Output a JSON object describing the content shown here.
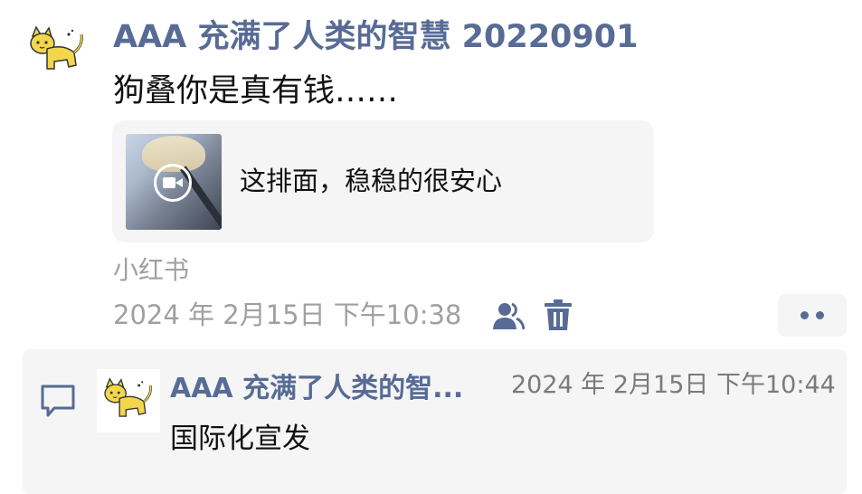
{
  "post": {
    "author": "AAA 充满了人类的智慧 20220901",
    "text": "狗叠你是真有钱……",
    "avatar_icon": "yellow-cat-icon",
    "link_card": {
      "title": "这排面，稳稳的很安心",
      "thumb_icon": "video-play-icon"
    },
    "source": "小红书",
    "timestamp": "2024 年 2月15日 下午10:38",
    "visibility_icon": "friends-icon",
    "delete_icon": "trash-icon",
    "more_icon": "more-dots-icon"
  },
  "comment": {
    "icon": "comment-bubble-icon",
    "avatar_icon": "yellow-cat-icon",
    "author": "AAA 充满了人类的智...",
    "time": "2024 年 2月15日 下午10:44",
    "text": "国际化宣发"
  },
  "colors": {
    "link_blue": "#576b95",
    "gray_text": "#a0a0a0",
    "card_bg": "#f5f5f5",
    "cat_yellow": "#f3d64a"
  }
}
